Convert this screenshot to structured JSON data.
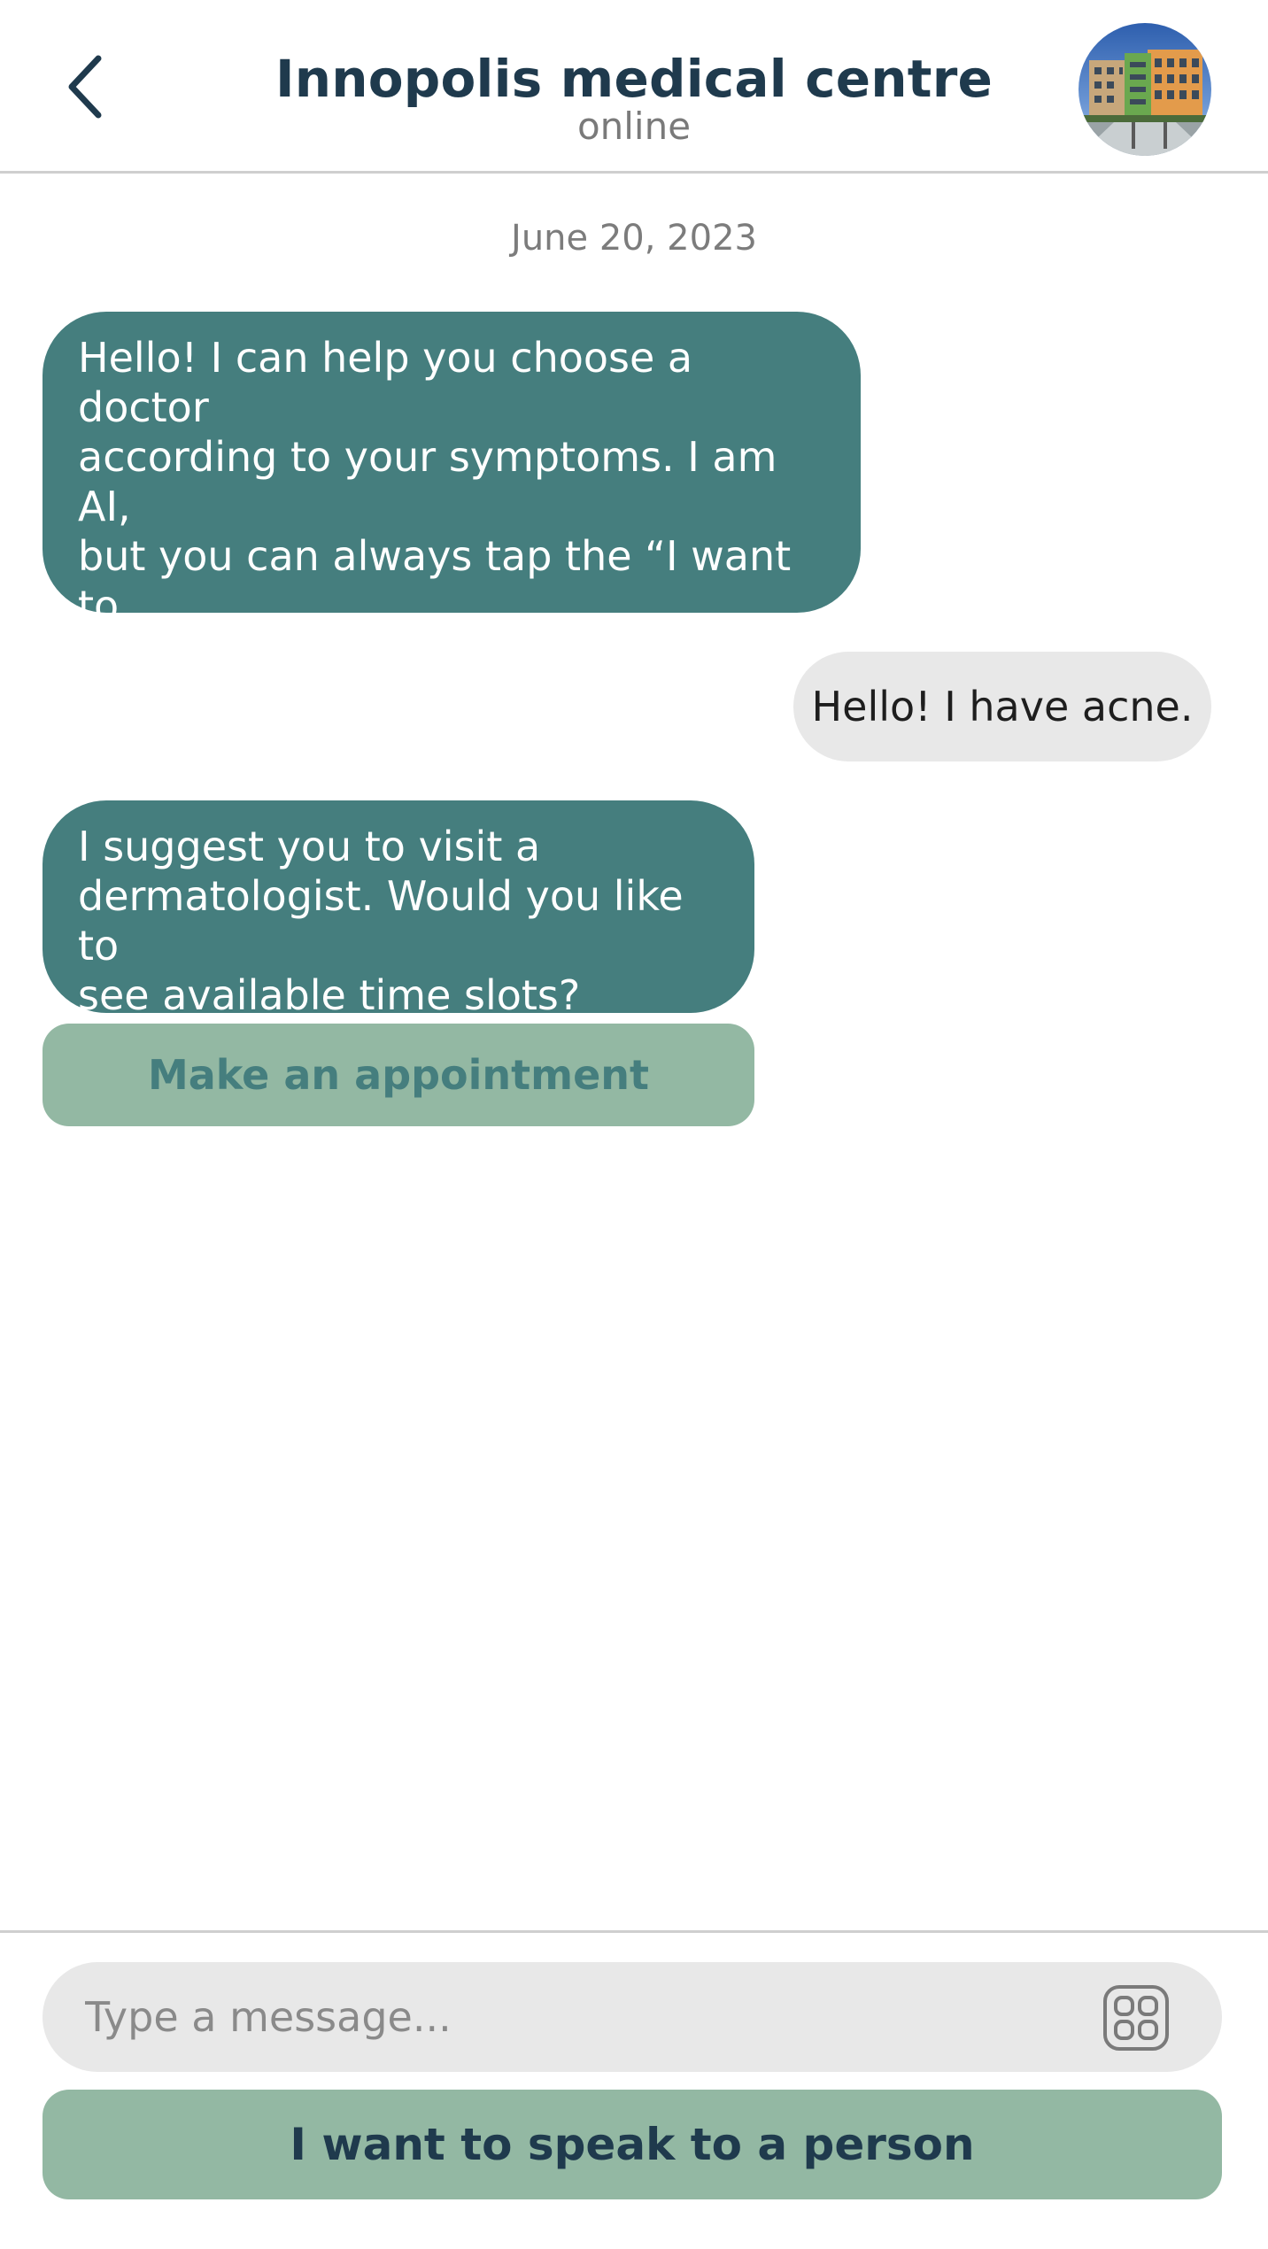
{
  "header": {
    "title": "Innopolis medical centre",
    "status": "online"
  },
  "chat": {
    "date": "June 20, 2023",
    "messages": [
      {
        "from": "bot",
        "text": "Hello! I can help you choose a doctor\naccording to your symptoms. I am AI,\nbut you can always tap the “I want to\nspeak to a person” button to start a\nchat with call centre."
      },
      {
        "from": "user",
        "text": "Hello! I have acne."
      },
      {
        "from": "bot",
        "text": "I suggest you to visit a\ndermatologist. Would you like to\nsee available time slots?"
      }
    ],
    "appointment_button": "Make an appointment"
  },
  "composer": {
    "placeholder": "Type a message...",
    "speak_button": "I want to speak to a person"
  },
  "colors": {
    "bot_bubble": "#457e7e",
    "user_bubble": "#e8e8e8",
    "button_bg": "#93b8a3",
    "title": "#1f3a4d"
  },
  "icons": {
    "back": "chevron-left-icon",
    "attach": "apps-grid-icon"
  }
}
